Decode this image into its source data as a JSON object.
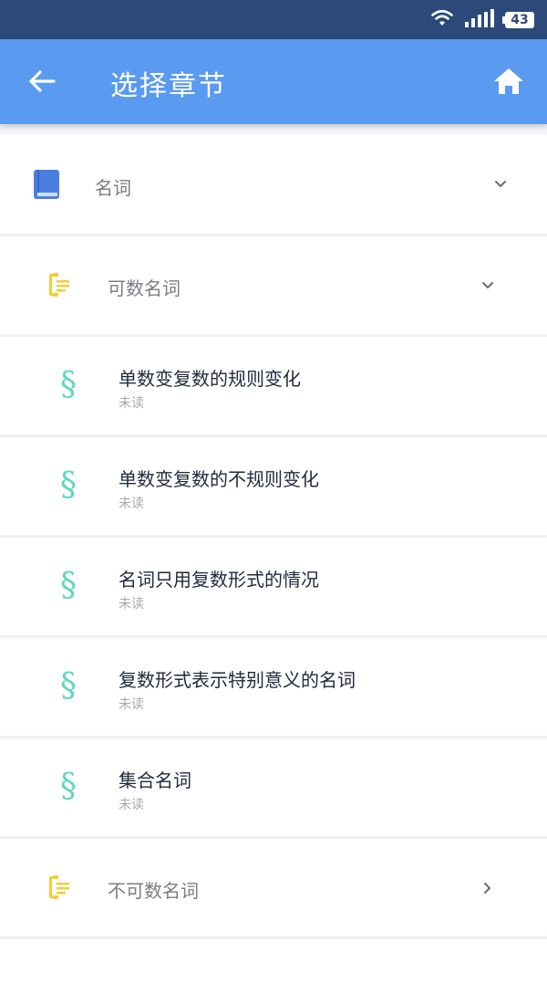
{
  "status_bar": {
    "battery": "43",
    "icons": [
      "wifi-icon",
      "signal-icon",
      "battery-icon"
    ]
  },
  "app_bar": {
    "title": "选择章节",
    "back_icon": "arrow-left-icon",
    "home_icon": "home-icon",
    "color": "#5a9af0"
  },
  "colors": {
    "chapter_icon": "#4a7fe0",
    "section_icon": "#f0cf38",
    "topic_icon": "#5fd6c3"
  },
  "list": {
    "chapter": {
      "label": "名词",
      "icon": "book-icon",
      "chevron": "chevron-down-icon"
    },
    "sections": [
      {
        "label": "可数名词",
        "icon": "clipboard-icon",
        "chevron": "chevron-down-icon",
        "topics": [
          {
            "title": "单数变复数的规则变化",
            "status": "未读",
            "icon": "section-sign-icon"
          },
          {
            "title": "单数变复数的不规则变化",
            "status": "未读",
            "icon": "section-sign-icon"
          },
          {
            "title": "名词只用复数形式的情况",
            "status": "未读",
            "icon": "section-sign-icon"
          },
          {
            "title": "复数形式表示特别意义的名词",
            "status": "未读",
            "icon": "section-sign-icon"
          },
          {
            "title": "集合名词",
            "status": "未读",
            "icon": "section-sign-icon"
          }
        ]
      },
      {
        "label": "不可数名词",
        "icon": "clipboard-icon",
        "chevron": "chevron-right-icon"
      }
    ]
  }
}
